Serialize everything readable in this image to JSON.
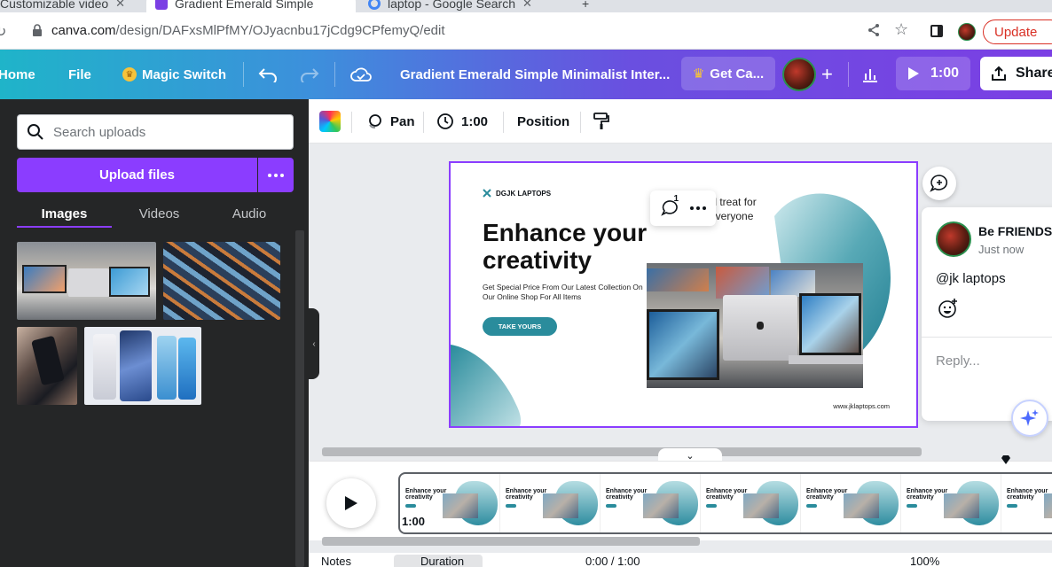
{
  "browser": {
    "tabs": [
      {
        "title": "Customizable video"
      },
      {
        "title": "Gradient Emerald Simple"
      },
      {
        "title": "laptop - Google Search"
      }
    ],
    "url_domain": "canva.com",
    "url_path": "/design/DAFxsMlPfMY/OJyacnbu17jCdg9CPfemyQ/edit",
    "update_label": "Update"
  },
  "header": {
    "home": "Home",
    "file": "File",
    "magic_switch": "Magic Switch",
    "doc_title": "Gradient Emerald Simple Minimalist Inter...",
    "get_canva": "Get Ca...",
    "duration": "1:00",
    "share": "Share"
  },
  "left_panel": {
    "search_placeholder": "Search uploads",
    "upload_label": "Upload files",
    "tabs": [
      "Images",
      "Videos",
      "Audio"
    ],
    "active_tab": "Images"
  },
  "toolbar": {
    "pan": "Pan",
    "duration": "1:00",
    "position": "Position"
  },
  "slide": {
    "brand": "DGJK LAPTOPS",
    "headline": "Enhance your creativity",
    "subtext": "Get Special Price From Our Latest Collection On Our Online Shop For All Items",
    "cta": "TAKE YOURS",
    "tagline_line1": "ual treat for",
    "tagline_line2": "everyone",
    "website": "www.jklaptops.com",
    "teal": "#2a8c9c"
  },
  "comment_popup": {
    "count": "1"
  },
  "comment": {
    "author": "Be FRIENDS",
    "time": "Just now",
    "message": "@jk laptops",
    "reply_placeholder": "Reply..."
  },
  "timeline": {
    "duration": "1:00",
    "frame_headline": "Enhance your creativity"
  },
  "footer": {
    "notes": "Notes",
    "tab_label": "Duration",
    "time": "0:00 / 1:00",
    "zoom": "100%"
  }
}
